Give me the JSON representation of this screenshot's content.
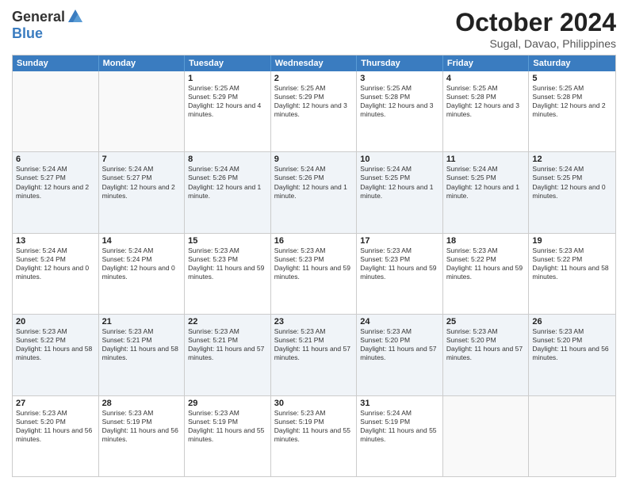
{
  "header": {
    "logo_general": "General",
    "logo_blue": "Blue",
    "month_year": "October 2024",
    "location": "Sugal, Davao, Philippines"
  },
  "calendar": {
    "days_of_week": [
      "Sunday",
      "Monday",
      "Tuesday",
      "Wednesday",
      "Thursday",
      "Friday",
      "Saturday"
    ],
    "rows": [
      [
        {
          "day": "",
          "empty": true,
          "info": ""
        },
        {
          "day": "",
          "empty": true,
          "info": ""
        },
        {
          "day": "1",
          "info": "Sunrise: 5:25 AM\nSunset: 5:29 PM\nDaylight: 12 hours and 4 minutes."
        },
        {
          "day": "2",
          "info": "Sunrise: 5:25 AM\nSunset: 5:29 PM\nDaylight: 12 hours and 3 minutes."
        },
        {
          "day": "3",
          "info": "Sunrise: 5:25 AM\nSunset: 5:28 PM\nDaylight: 12 hours and 3 minutes."
        },
        {
          "day": "4",
          "info": "Sunrise: 5:25 AM\nSunset: 5:28 PM\nDaylight: 12 hours and 3 minutes."
        },
        {
          "day": "5",
          "info": "Sunrise: 5:25 AM\nSunset: 5:28 PM\nDaylight: 12 hours and 2 minutes."
        }
      ],
      [
        {
          "day": "6",
          "info": "Sunrise: 5:24 AM\nSunset: 5:27 PM\nDaylight: 12 hours and 2 minutes."
        },
        {
          "day": "7",
          "info": "Sunrise: 5:24 AM\nSunset: 5:27 PM\nDaylight: 12 hours and 2 minutes."
        },
        {
          "day": "8",
          "info": "Sunrise: 5:24 AM\nSunset: 5:26 PM\nDaylight: 12 hours and 1 minute."
        },
        {
          "day": "9",
          "info": "Sunrise: 5:24 AM\nSunset: 5:26 PM\nDaylight: 12 hours and 1 minute."
        },
        {
          "day": "10",
          "info": "Sunrise: 5:24 AM\nSunset: 5:25 PM\nDaylight: 12 hours and 1 minute."
        },
        {
          "day": "11",
          "info": "Sunrise: 5:24 AM\nSunset: 5:25 PM\nDaylight: 12 hours and 1 minute."
        },
        {
          "day": "12",
          "info": "Sunrise: 5:24 AM\nSunset: 5:25 PM\nDaylight: 12 hours and 0 minutes."
        }
      ],
      [
        {
          "day": "13",
          "info": "Sunrise: 5:24 AM\nSunset: 5:24 PM\nDaylight: 12 hours and 0 minutes."
        },
        {
          "day": "14",
          "info": "Sunrise: 5:24 AM\nSunset: 5:24 PM\nDaylight: 12 hours and 0 minutes."
        },
        {
          "day": "15",
          "info": "Sunrise: 5:23 AM\nSunset: 5:23 PM\nDaylight: 11 hours and 59 minutes."
        },
        {
          "day": "16",
          "info": "Sunrise: 5:23 AM\nSunset: 5:23 PM\nDaylight: 11 hours and 59 minutes."
        },
        {
          "day": "17",
          "info": "Sunrise: 5:23 AM\nSunset: 5:23 PM\nDaylight: 11 hours and 59 minutes."
        },
        {
          "day": "18",
          "info": "Sunrise: 5:23 AM\nSunset: 5:22 PM\nDaylight: 11 hours and 59 minutes."
        },
        {
          "day": "19",
          "info": "Sunrise: 5:23 AM\nSunset: 5:22 PM\nDaylight: 11 hours and 58 minutes."
        }
      ],
      [
        {
          "day": "20",
          "info": "Sunrise: 5:23 AM\nSunset: 5:22 PM\nDaylight: 11 hours and 58 minutes."
        },
        {
          "day": "21",
          "info": "Sunrise: 5:23 AM\nSunset: 5:21 PM\nDaylight: 11 hours and 58 minutes."
        },
        {
          "day": "22",
          "info": "Sunrise: 5:23 AM\nSunset: 5:21 PM\nDaylight: 11 hours and 57 minutes."
        },
        {
          "day": "23",
          "info": "Sunrise: 5:23 AM\nSunset: 5:21 PM\nDaylight: 11 hours and 57 minutes."
        },
        {
          "day": "24",
          "info": "Sunrise: 5:23 AM\nSunset: 5:20 PM\nDaylight: 11 hours and 57 minutes."
        },
        {
          "day": "25",
          "info": "Sunrise: 5:23 AM\nSunset: 5:20 PM\nDaylight: 11 hours and 57 minutes."
        },
        {
          "day": "26",
          "info": "Sunrise: 5:23 AM\nSunset: 5:20 PM\nDaylight: 11 hours and 56 minutes."
        }
      ],
      [
        {
          "day": "27",
          "info": "Sunrise: 5:23 AM\nSunset: 5:20 PM\nDaylight: 11 hours and 56 minutes."
        },
        {
          "day": "28",
          "info": "Sunrise: 5:23 AM\nSunset: 5:19 PM\nDaylight: 11 hours and 56 minutes."
        },
        {
          "day": "29",
          "info": "Sunrise: 5:23 AM\nSunset: 5:19 PM\nDaylight: 11 hours and 55 minutes."
        },
        {
          "day": "30",
          "info": "Sunrise: 5:23 AM\nSunset: 5:19 PM\nDaylight: 11 hours and 55 minutes."
        },
        {
          "day": "31",
          "info": "Sunrise: 5:24 AM\nSunset: 5:19 PM\nDaylight: 11 hours and 55 minutes."
        },
        {
          "day": "",
          "empty": true,
          "info": ""
        },
        {
          "day": "",
          "empty": true,
          "info": ""
        }
      ]
    ]
  }
}
